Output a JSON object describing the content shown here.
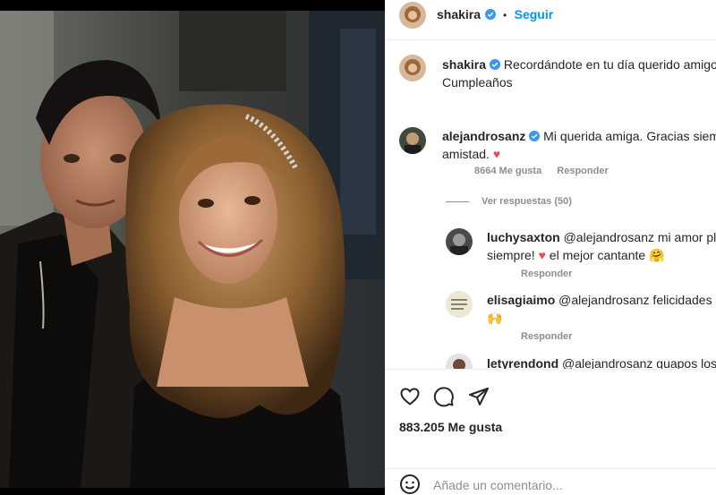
{
  "post": {
    "author": "shakira",
    "follow_label": "Seguir",
    "separator": "•",
    "caption": {
      "username": "shakira",
      "line1": "Recordándote en tu día querido amigo. F",
      "line2": "Cumpleaños"
    }
  },
  "comments": [
    {
      "username": "alejandrosanz",
      "line1": "Mi querida amiga. Gracias siempre",
      "line2": "amistad.",
      "emoji": "♥",
      "likes": "8664 Me gusta",
      "reply": "Responder",
      "view_replies": "Ver respuestas (50)"
    }
  ],
  "replies": [
    {
      "username": "luchysaxton",
      "line1": "@alejandrosanz mi amor plato",
      "line2a": "siempre!",
      "heart": "♥",
      "line2b": "el mejor cantante",
      "emoji": "🤗",
      "reply": "Responder"
    },
    {
      "username": "elisagiaimo",
      "line1": "@alejandrosanz felicidades Gu",
      "emoji": "🙌",
      "reply": "Responder"
    },
    {
      "username": "letyrendond",
      "line1": "@alejandrosanz guapos los d"
    }
  ],
  "actions": {
    "like_icon": "heart-outline-icon",
    "comment_icon": "comment-bubble-icon",
    "share_icon": "paper-plane-icon",
    "likes_count": "883.205 Me gusta",
    "emoji_icon": "smiley-icon",
    "comment_placeholder": "Añade un comentario..."
  },
  "colors": {
    "link_blue": "#0095f6",
    "verified_blue": "#3897f0",
    "heart_red": "#ed4956",
    "meta_gray": "#8e8e8e"
  }
}
